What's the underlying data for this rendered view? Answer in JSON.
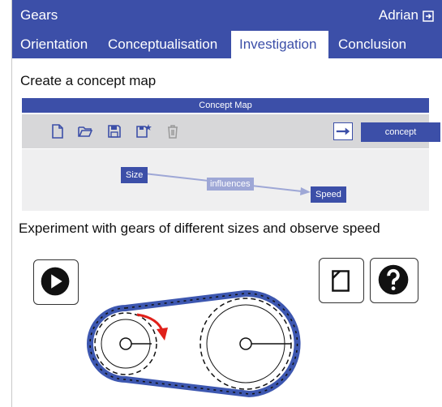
{
  "app": {
    "title": "Gears",
    "user": "Adrian"
  },
  "tabs": [
    {
      "label": "Orientation",
      "active": false
    },
    {
      "label": "Conceptualisation",
      "active": false
    },
    {
      "label": "Investigation",
      "active": true
    },
    {
      "label": "Conclusion",
      "active": false
    }
  ],
  "concept_map": {
    "section_title": "Create a concept map",
    "header": "Concept Map",
    "toolbar": [
      "new-file-icon",
      "open-folder-icon",
      "save-icon",
      "save-star-icon",
      "trash-icon"
    ],
    "concept_button": "concept",
    "nodes": {
      "size": "Size",
      "speed": "Speed"
    },
    "link_label": "influences"
  },
  "experiment": {
    "title": "Experiment with gears of different sizes and observe speed",
    "buttons": [
      "play-icon",
      "note-icon",
      "help-icon"
    ]
  },
  "colors": {
    "brand": "#3c4fa8",
    "chain": "#3d57b0",
    "arrow": "#e0201a"
  }
}
